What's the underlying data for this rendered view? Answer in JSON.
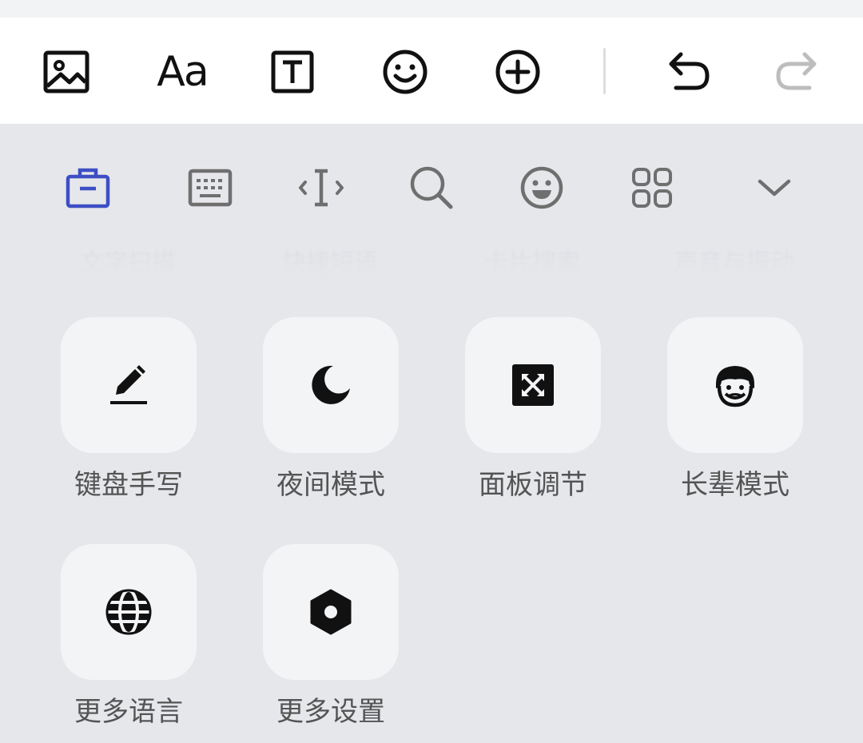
{
  "top_toolbar": {
    "font_button_label": "Aa",
    "icons": [
      "image-icon",
      "font-icon",
      "text-box-icon",
      "emoji-icon",
      "add-icon",
      "undo-icon",
      "redo-icon"
    ]
  },
  "keyboard_toolbar": {
    "icons": [
      "toolbox-icon",
      "keyboard-icon",
      "cursor-icon",
      "search-icon",
      "emoji-icon",
      "apps-grid-icon",
      "collapse-chevron-icon"
    ],
    "active_color": "#3d4fc4"
  },
  "faded_row": {
    "labels": [
      "文字扫描",
      "快捷短语",
      "卡片搜索",
      "声音与振动"
    ]
  },
  "tiles": [
    {
      "label": "键盘手写",
      "icon": "pen-icon"
    },
    {
      "label": "夜间模式",
      "icon": "moon-icon"
    },
    {
      "label": "面板调节",
      "icon": "resize-icon"
    },
    {
      "label": "长辈模式",
      "icon": "elder-face-icon"
    },
    {
      "label": "更多语言",
      "icon": "globe-icon"
    },
    {
      "label": "更多设置",
      "icon": "settings-hexagon-icon"
    }
  ]
}
